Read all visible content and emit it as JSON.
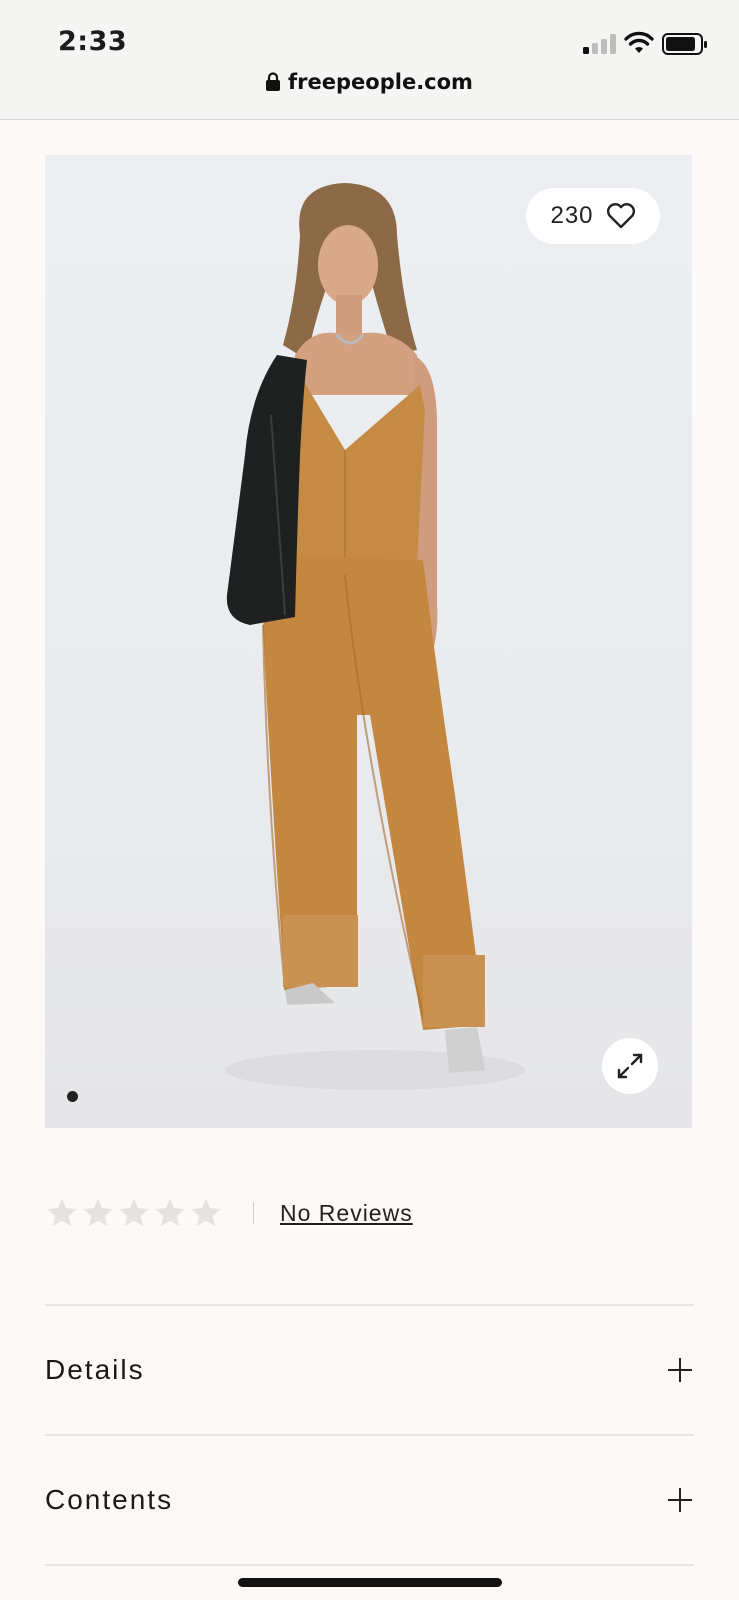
{
  "status": {
    "time": "2:33",
    "url": "freepeople.com"
  },
  "product": {
    "favorites_count": "230",
    "image_icon": "heart-icon",
    "expand_icon": "expand-icon",
    "rating_stars": 0,
    "reviews_link": "No Reviews"
  },
  "accordion": {
    "items": [
      {
        "label": "Details"
      },
      {
        "label": "Contents"
      }
    ]
  },
  "colors": {
    "page_bg": "#fcf9f7",
    "top_color": "#c58b45",
    "pants_color": "#c48740",
    "jacket_color": "#1e211f",
    "star_empty": "#e6e2df"
  }
}
